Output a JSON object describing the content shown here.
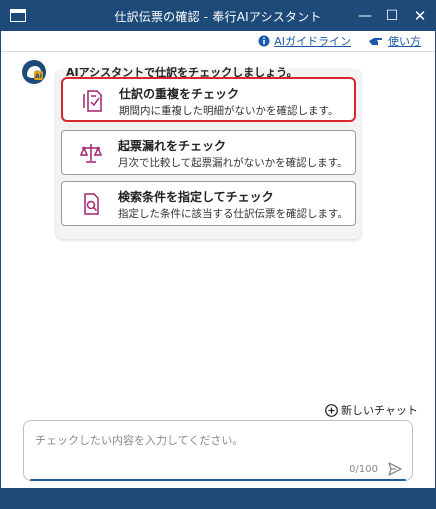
{
  "window": {
    "title": "仕訳伝票の確認 - 奉行AIアシスタント",
    "minimize_glyph": "—",
    "maximize_glyph": "☐",
    "close_glyph": "✕"
  },
  "links": {
    "guide_label": "AIガイドライン",
    "usage_label": "使い方"
  },
  "chat": {
    "greeting": "AIアシスタントで仕訳をチェックしましょう。",
    "avatar_text": "AI",
    "cards": [
      {
        "title": "仕訳の重複をチェック",
        "desc": "期間内に重複した明細がないかを確認します。",
        "icon": "document-check-icon"
      },
      {
        "title": "起票漏れをチェック",
        "desc": "月次で比較して起票漏れがないかを確認します。",
        "icon": "balance-scale-icon"
      },
      {
        "title": "検索条件を指定してチェック",
        "desc": "指定した条件に該当する仕訳伝票を確認します。",
        "icon": "document-search-icon"
      }
    ]
  },
  "composer": {
    "new_chat_label": "新しいチャット",
    "placeholder": "チェックしたい内容を入力してください。",
    "value": "",
    "counter": "0/100"
  },
  "colors": {
    "titlebar": "#1e4a7a",
    "accent_link": "#1a5aa8",
    "selected_border": "#d8262f",
    "icon_magenta": "#a0246e"
  }
}
